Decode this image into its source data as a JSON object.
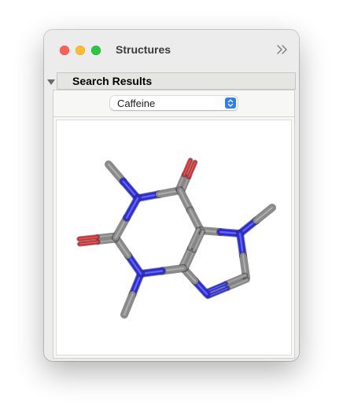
{
  "window": {
    "title": "Structures",
    "controls": [
      "close",
      "minimize",
      "zoom"
    ],
    "overflow_icon": "chevron-double-right-icon"
  },
  "section": {
    "title": "Search Results",
    "expanded": true
  },
  "compound_select": {
    "selected": "Caffeine"
  },
  "molecule": {
    "name": "Caffeine",
    "style": "sticks",
    "colors": {
      "carbon": "#8a8a8a",
      "nitrogen": "#2a2ae0",
      "oxygen": "#d8252a"
    }
  }
}
